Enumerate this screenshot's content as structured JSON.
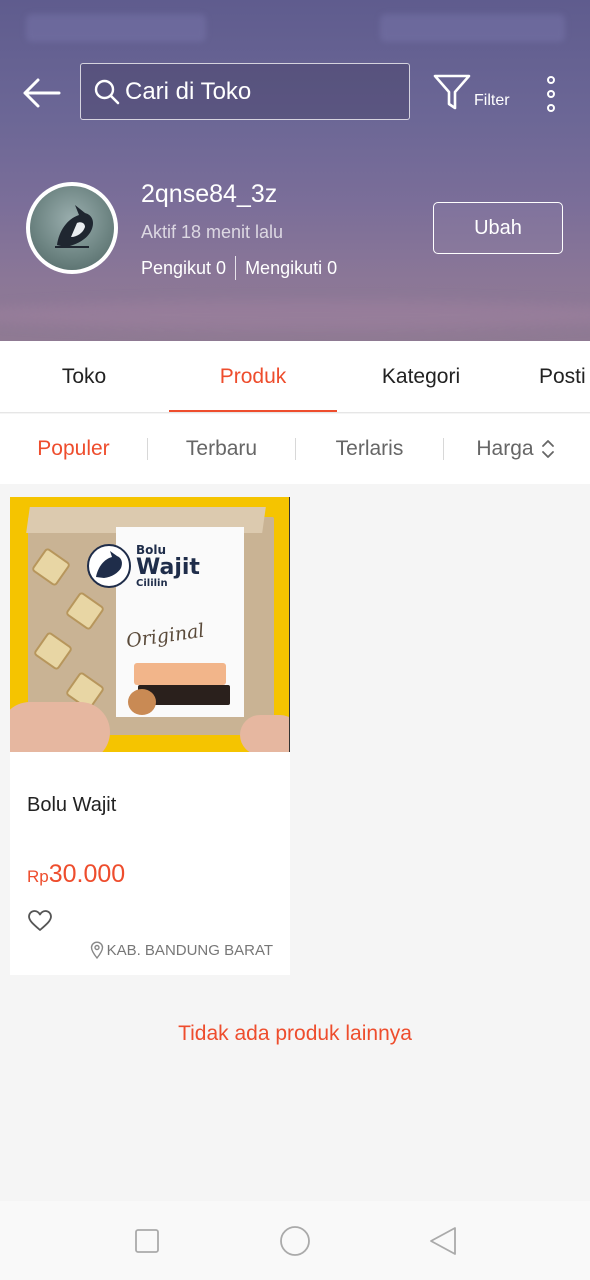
{
  "header": {
    "search_placeholder": "Cari di Toko",
    "filter_label": "Filter"
  },
  "shop": {
    "name": "2qnse84_3z",
    "active_status": "Aktif 18 menit lalu",
    "followers": "Pengikut 0",
    "following": "Mengikuti 0",
    "edit_button": "Ubah"
  },
  "tabs": [
    {
      "label": "Toko",
      "active": false
    },
    {
      "label": "Produk",
      "active": true
    },
    {
      "label": "Kategori",
      "active": false
    },
    {
      "label": "Posti",
      "active": false
    }
  ],
  "sort_options": [
    {
      "label": "Populer",
      "active": true
    },
    {
      "label": "Terbaru",
      "active": false
    },
    {
      "label": "Terlaris",
      "active": false
    },
    {
      "label": "Harga",
      "active": false
    }
  ],
  "product": {
    "title": "Bolu Wajit",
    "currency": "Rp",
    "price": "30.000",
    "location": "KAB. BANDUNG BARAT",
    "image_brand_line1": "Bolu",
    "image_brand_line2": "Wajit",
    "image_brand_line3": "Cililin",
    "image_tagline": "Original"
  },
  "footer_text": "Tidak ada produk lainnya",
  "colors": {
    "accent": "#ee4d2d"
  }
}
